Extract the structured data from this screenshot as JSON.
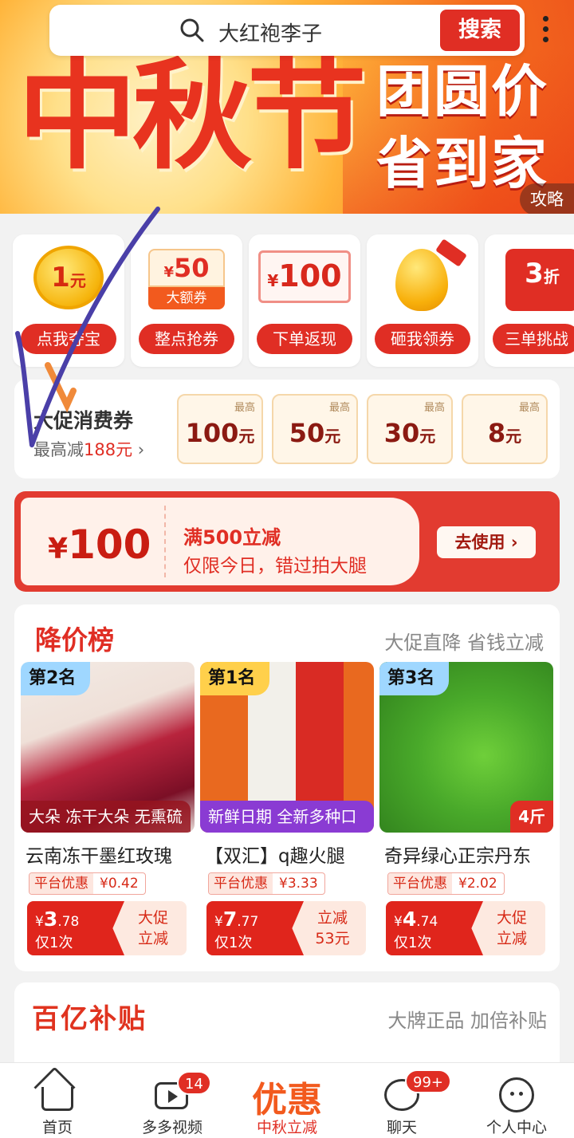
{
  "search": {
    "placeholder": "大红袍李子",
    "button": "搜索"
  },
  "hero": {
    "title": "中秋节",
    "subtitle_1": "团圆价",
    "subtitle_2": "省到家",
    "tag": "攻略"
  },
  "entries": [
    {
      "badge_main": "1",
      "badge_unit": "元",
      "label": "点我夺宝"
    },
    {
      "badge_symbol": "¥",
      "badge_main": "50",
      "badge_sub": "大额券",
      "label": "整点抢券"
    },
    {
      "badge_symbol": "¥",
      "badge_main": "100",
      "label": "下单返现"
    },
    {
      "label": "砸我领券"
    },
    {
      "badge_main": "3",
      "badge_unit": "折",
      "label": "三单挑战"
    }
  ],
  "vouchers": {
    "title": "大促消费券",
    "sub_prefix": "最高减",
    "sub_amount": "188元",
    "cards": [
      {
        "cap": "最高",
        "amount": "100",
        "unit": "元"
      },
      {
        "cap": "最高",
        "amount": "50",
        "unit": "元"
      },
      {
        "cap": "最高",
        "amount": "30",
        "unit": "元"
      },
      {
        "cap": "最高",
        "amount": "8",
        "unit": "元"
      }
    ]
  },
  "big_coupon": {
    "symbol": "¥",
    "amount": "100",
    "condition": "满500立减",
    "note": "仅限今日，错过拍大腿",
    "button": "去使用"
  },
  "price_drop": {
    "title": "降价榜",
    "subtitle": "大促直降 省钱立减",
    "products": [
      {
        "rank": "第2名",
        "image_label": "大朵 冻干大朵 无熏硫",
        "title": "云南冻干墨红玫瑰",
        "promo_label": "平台优惠",
        "promo_value": "¥0.42",
        "price_symbol": "¥",
        "price_int": "3",
        "price_dec": ".78",
        "limit": "仅1次",
        "right_1": "大促",
        "right_2": "立减"
      },
      {
        "rank": "第1名",
        "image_label": "新鲜日期 全新多种口味",
        "title": "【双汇】q趣火腿",
        "promo_label": "平台优惠",
        "promo_value": "¥3.33",
        "price_symbol": "¥",
        "price_int": "7",
        "price_dec": ".77",
        "limit": "仅1次",
        "right_1": "立减",
        "right_2": "53元"
      },
      {
        "rank": "第3名",
        "image_label": "4斤",
        "title": "奇异绿心正宗丹东",
        "promo_label": "平台优惠",
        "promo_value": "¥2.02",
        "price_symbol": "¥",
        "price_int": "4",
        "price_dec": ".74",
        "limit": "仅1次",
        "right_1": "大促",
        "right_2": "立减"
      }
    ]
  },
  "subsidy": {
    "title": "百亿补贴",
    "subtitle": "大牌正品 加倍补贴"
  },
  "tabbar": {
    "tabs": [
      {
        "label": "首页"
      },
      {
        "label": "多多视频",
        "badge": "14"
      },
      {
        "big": "优惠",
        "label": "中秋立减"
      },
      {
        "label": "聊天",
        "badge": "99+"
      },
      {
        "label": "个人中心"
      }
    ]
  },
  "colors": {
    "primary_red": "#e02e24",
    "orange": "#f25a1e",
    "annotation_purple": "#4a3fa8",
    "annotation_orange": "#f08a3a"
  }
}
